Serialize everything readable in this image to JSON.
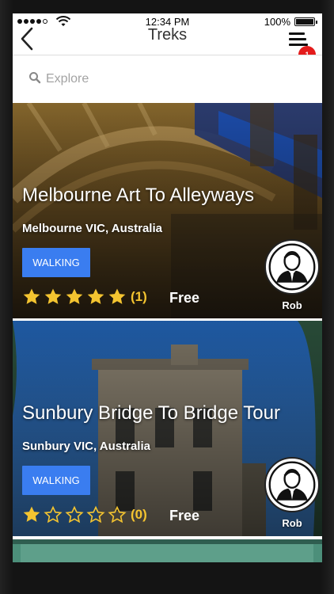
{
  "status_bar": {
    "time": "12:34 PM",
    "battery": "100%",
    "signal_bars_filled": 4,
    "signal_bars_total": 5
  },
  "nav": {
    "title": "Treks",
    "back_icon": "chevron-left-icon",
    "menu_icon": "hamburger-menu-icon",
    "notification_count": "1"
  },
  "search": {
    "placeholder": "Explore",
    "value": ""
  },
  "treks": [
    {
      "title": "Melbourne Art To Alleyways",
      "location": "Melbourne VIC, Australia",
      "category": "WALKING",
      "rating_stars": 5,
      "rating_count": "(1)",
      "price": "Free",
      "guide": "Rob"
    },
    {
      "title": "Sunbury Bridge To Bridge Tour",
      "location": "Sunbury VIC, Australia",
      "category": "WALKING",
      "rating_stars": 1,
      "rating_count": "(0)",
      "price": "Free",
      "guide": "Rob"
    }
  ],
  "colors": {
    "tag_blue": "#3a7df0",
    "star_gold": "#f4c430",
    "badge_red": "#e41b1b"
  }
}
